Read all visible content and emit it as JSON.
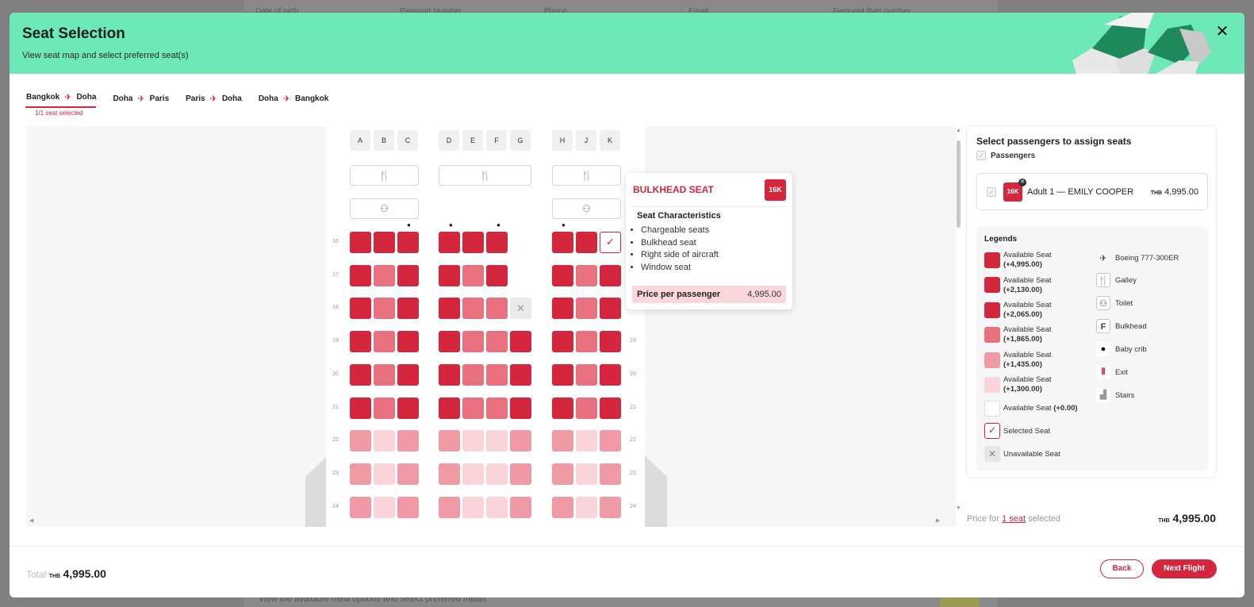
{
  "background": {
    "top_labels": [
      "Date of birth",
      "Passport Number",
      "Phone",
      "Email",
      "Frequent flyer number"
    ],
    "bottom_text": "View the available meal options and select preferred meals"
  },
  "header": {
    "title": "Seat Selection",
    "subtitle": "View seat map and select preferred seat(s)",
    "close_icon": "close-icon"
  },
  "tabs": [
    {
      "from": "Bangkok",
      "to": "Doha",
      "active": true
    },
    {
      "from": "Doha",
      "to": "Paris",
      "active": false
    },
    {
      "from": "Paris",
      "to": "Doha",
      "active": false
    },
    {
      "from": "Doha",
      "to": "Bangkok",
      "active": false
    }
  ],
  "tab_status": "1/1 seat selected",
  "seatmap": {
    "columns": [
      "A",
      "B",
      "C",
      "D",
      "E",
      "F",
      "G",
      "H",
      "J",
      "K"
    ],
    "rows": [
      "16",
      "17",
      "18",
      "19",
      "20",
      "21",
      "22",
      "23",
      "24"
    ],
    "seats": {
      "16": [
        "c1",
        "c1",
        "c1",
        "c1",
        "c1",
        "c1",
        "none",
        "c1",
        "c1",
        "sel"
      ],
      "17": [
        "c1",
        "c2",
        "c1",
        "c1",
        "c2",
        "c1",
        "none",
        "c1",
        "c2",
        "c1"
      ],
      "18": [
        "c1",
        "c2",
        "c1",
        "c1",
        "c2",
        "c2",
        "un",
        "c1",
        "c2",
        "c1"
      ],
      "19": [
        "c1",
        "c2",
        "c1",
        "c1",
        "c2",
        "c2",
        "c1",
        "c1",
        "c2",
        "c1"
      ],
      "20": [
        "c1",
        "c2",
        "c1",
        "c1",
        "c2",
        "c2",
        "c1",
        "c1",
        "c2",
        "c1"
      ],
      "21": [
        "c1",
        "c2",
        "c1",
        "c1",
        "c2",
        "c2",
        "c1",
        "c1",
        "c2",
        "c1"
      ],
      "22": [
        "c3",
        "c4",
        "c3",
        "c3",
        "c4",
        "c4",
        "c3",
        "c3",
        "c4",
        "c3"
      ],
      "23": [
        "c3",
        "c4",
        "c3",
        "c3",
        "c4",
        "c4",
        "c3",
        "c3",
        "c4",
        "c3"
      ],
      "24": [
        "c3",
        "c4",
        "c3",
        "c3",
        "c4",
        "c4",
        "c3",
        "c3",
        "c4",
        "c3"
      ]
    }
  },
  "tooltip": {
    "title": "BULKHEAD SEAT",
    "seat": "16K",
    "subtitle": "Seat Characteristics",
    "characteristics": [
      "Chargeable seats",
      "Bulkhead seat",
      "Right side of aircraft",
      "Window seat"
    ],
    "price_label": "Price per passenger",
    "price_value": "4,995.00"
  },
  "panel": {
    "title": "Select passengers to assign seats",
    "passengers_label": "Passengers",
    "passenger": {
      "seat": "16K",
      "name": "Adult 1 — EMILY COOPER",
      "currency": "THB",
      "price": "4,995.00"
    },
    "legends_title": "Legends",
    "seat_legend": [
      {
        "label": "Available Seat",
        "price": "(+4,995.00)",
        "color": "#d4263d"
      },
      {
        "label": "Available Seat",
        "price": "(+2,130.00)",
        "color": "#d4263d"
      },
      {
        "label": "Available Seat",
        "price": "(+2,065.00)",
        "color": "#d4263d"
      },
      {
        "label": "Available Seat",
        "price": "(+1,865.00)",
        "color": "#e9707e"
      },
      {
        "label": "Available Seat",
        "price": "(+1,435.00)",
        "color": "#ef9aa5"
      },
      {
        "label": "Available Seat",
        "price": "(+1,300.00)",
        "color": "#fbd4d9"
      }
    ],
    "free_seat": {
      "label": "Available Seat",
      "price": "(+0.00)"
    },
    "selected_label": "Selected Seat",
    "unavailable_label": "Unavailable Seat",
    "icon_legend": [
      {
        "icon": "airplane-icon",
        "label": "Boeing 777-300ER"
      },
      {
        "icon": "galley-icon",
        "label": "Galley"
      },
      {
        "icon": "toilet-icon",
        "label": "Toilet"
      },
      {
        "icon": "bulkhead-icon",
        "label": "Bulkhead"
      },
      {
        "icon": "baby-crib-icon",
        "label": "Baby crib"
      },
      {
        "icon": "exit-icon",
        "label": "Exit"
      },
      {
        "icon": "stairs-icon",
        "label": "Stairs"
      }
    ]
  },
  "price_summary": {
    "prefix": "Price for",
    "link": "1 seat",
    "suffix": "selected",
    "currency": "THB",
    "amount": "4,995.00"
  },
  "footer": {
    "total_label": "Total",
    "currency": "THB",
    "amount": "4,995.00",
    "back": "Back",
    "next": "Next Flight"
  },
  "colors": {
    "accent": "#d4263d",
    "header_bg": "#6de8b7"
  }
}
